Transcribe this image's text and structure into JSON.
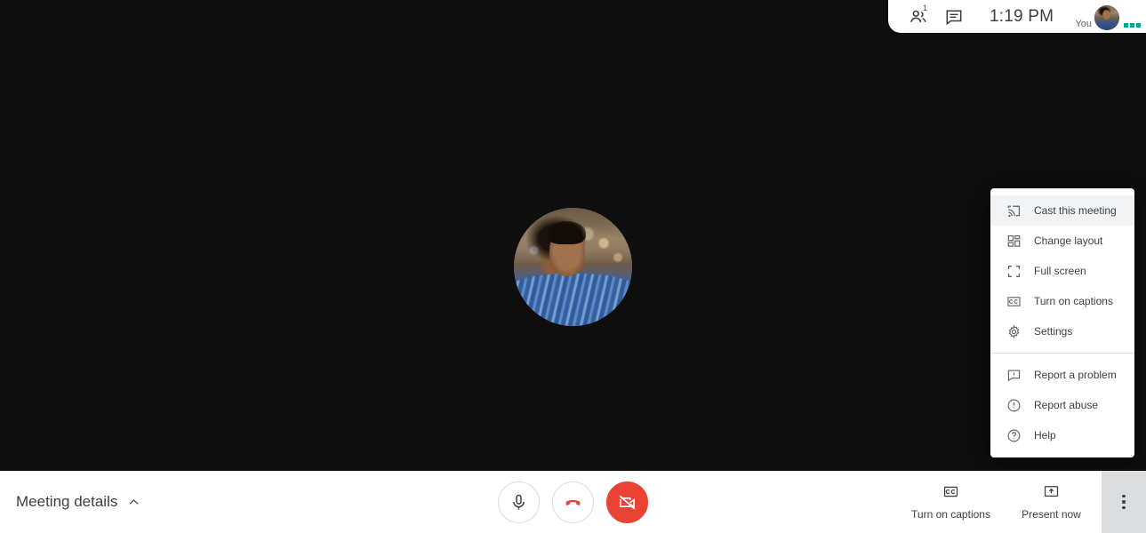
{
  "header": {
    "participants_icon": "people-icon",
    "participants_count": "1",
    "chat_icon": "chat-icon",
    "clock": "1:19 PM",
    "self_label": "You",
    "self_avatar": "self-avatar",
    "mic_activity_icon": "mic-activity-dots",
    "mic_activity_color": "#00a98f"
  },
  "stage": {
    "participant_avatar": "participant-avatar-photo",
    "background_color": "#101010"
  },
  "options_menu": {
    "groups": [
      {
        "items": [
          {
            "label": "Cast this meeting",
            "icon": "cast-icon",
            "active": true
          },
          {
            "label": "Change layout",
            "icon": "layout-icon",
            "active": false
          },
          {
            "label": "Full screen",
            "icon": "fullscreen-icon",
            "active": false
          },
          {
            "label": "Turn on captions",
            "icon": "captions-icon",
            "active": false
          },
          {
            "label": "Settings",
            "icon": "gear-icon",
            "active": false
          }
        ]
      },
      {
        "items": [
          {
            "label": "Report a problem",
            "icon": "report-problem-icon",
            "active": false
          },
          {
            "label": "Report abuse",
            "icon": "report-abuse-icon",
            "active": false
          },
          {
            "label": "Help",
            "icon": "help-icon",
            "active": false
          }
        ]
      }
    ]
  },
  "bottom_bar": {
    "meeting_details_label": "Meeting details",
    "meeting_details_chevron": "chevron-up-icon",
    "controls": [
      {
        "name": "microphone",
        "icon": "microphone-icon",
        "style": "outline"
      },
      {
        "name": "hang-up",
        "icon": "hang-up-icon",
        "style": "outline-red"
      },
      {
        "name": "camera",
        "icon": "camera-off-icon",
        "style": "filled-red"
      }
    ],
    "captions_label": "Turn on captions",
    "captions_icon": "captions-cc-icon",
    "present_label": "Present now",
    "present_icon": "present-screen-icon",
    "more_options_icon": "more-vertical-icon",
    "more_options_active_color": "#dcdddf",
    "danger_color": "#ea4335"
  }
}
